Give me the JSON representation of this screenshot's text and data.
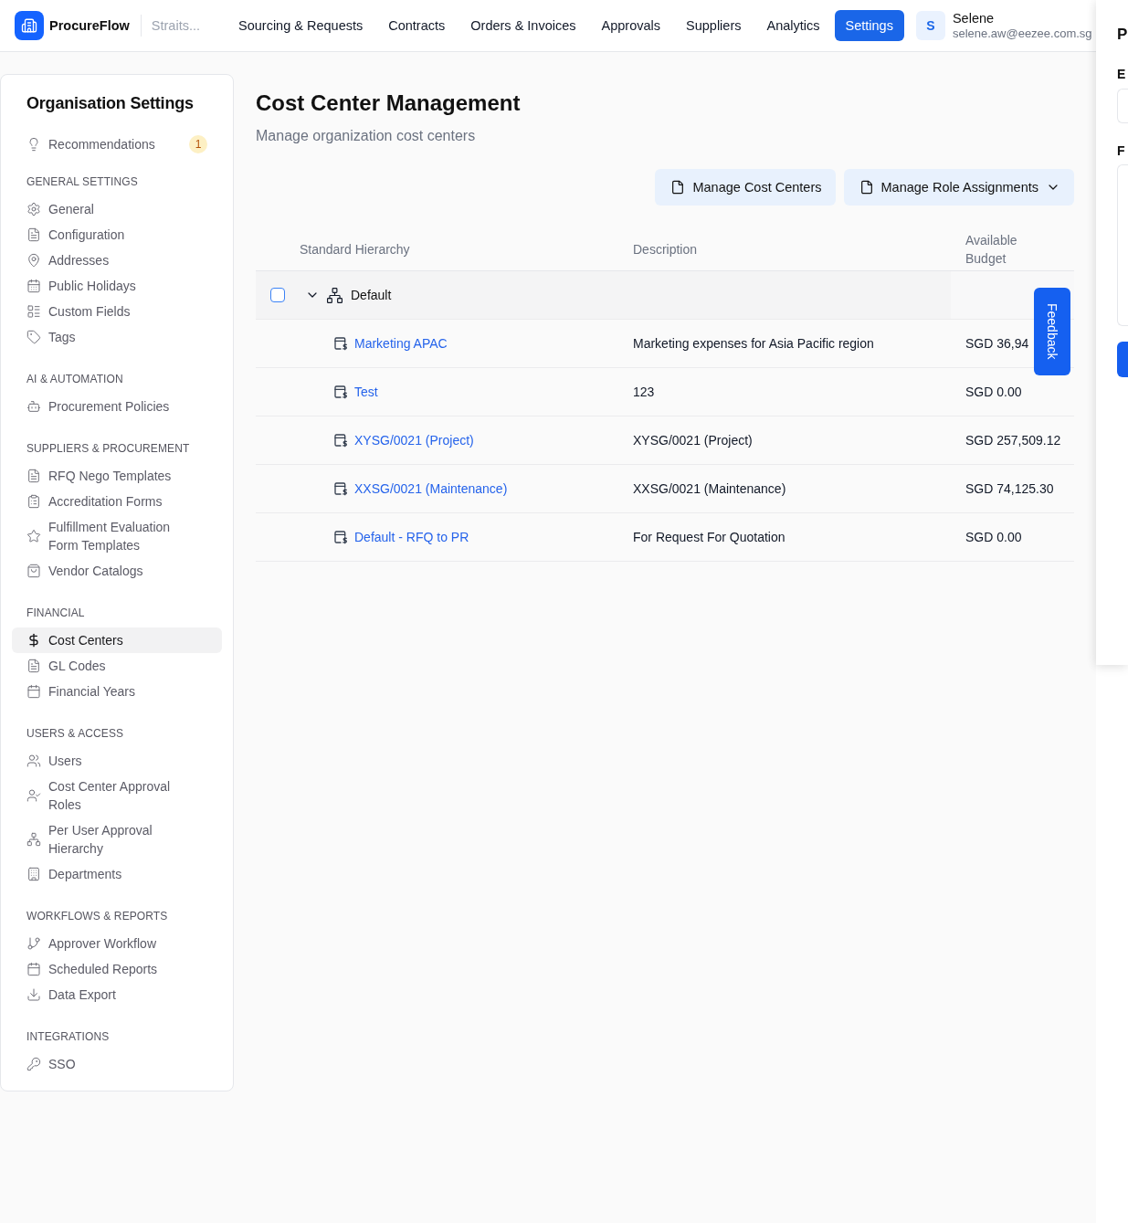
{
  "top_bar": {
    "brand": "ProcureFlow",
    "workspace": "Straits...",
    "nav": [
      {
        "label": "Sourcing & Requests",
        "selected": false
      },
      {
        "label": "Contracts",
        "selected": false
      },
      {
        "label": "Orders & Invoices",
        "selected": false
      },
      {
        "label": "Approvals",
        "selected": false
      },
      {
        "label": "Suppliers",
        "selected": false
      },
      {
        "label": "Analytics",
        "selected": false
      },
      {
        "label": "Settings",
        "selected": true
      }
    ],
    "user": {
      "avatar": "S",
      "name": "Selene",
      "email": "selene.aw@eezee.com.sg"
    }
  },
  "sidebar": {
    "title": "Organisation Settings",
    "recommendations": {
      "label": "Recommendations",
      "badge": "1",
      "selected": false
    },
    "sections": [
      {
        "heading": "GENERAL SETTINGS",
        "items": [
          {
            "label": "General",
            "selected": false
          },
          {
            "label": "Configuration",
            "selected": false
          },
          {
            "label": "Addresses",
            "selected": false
          },
          {
            "label": "Public Holidays",
            "selected": false
          },
          {
            "label": "Custom Fields",
            "selected": false
          },
          {
            "label": "Tags",
            "selected": false
          }
        ]
      },
      {
        "heading": "AI & AUTOMATION",
        "items": [
          {
            "label": "Procurement Policies",
            "selected": false
          }
        ]
      },
      {
        "heading": "SUPPLIERS & PROCUREMENT",
        "items": [
          {
            "label": "RFQ Nego Templates",
            "selected": false
          },
          {
            "label": "Accreditation Forms",
            "selected": false
          },
          {
            "label": "Fulfillment Evaluation Form Templates",
            "selected": false
          },
          {
            "label": "Vendor Catalogs",
            "selected": false
          }
        ]
      },
      {
        "heading": "FINANCIAL",
        "items": [
          {
            "label": "Cost Centers",
            "selected": true
          },
          {
            "label": "GL Codes",
            "selected": false
          },
          {
            "label": "Financial Years",
            "selected": false
          }
        ]
      },
      {
        "heading": "USERS & ACCESS",
        "items": [
          {
            "label": "Users",
            "selected": false
          },
          {
            "label": "Cost Center Approval Roles",
            "selected": false
          },
          {
            "label": "Per User Approval Hierarchy",
            "selected": false
          },
          {
            "label": "Departments",
            "selected": false
          }
        ]
      },
      {
        "heading": "WORKFLOWS & REPORTS",
        "items": [
          {
            "label": "Approver Workflow",
            "selected": false
          },
          {
            "label": "Scheduled Reports",
            "selected": false
          },
          {
            "label": "Data Export",
            "selected": false
          }
        ]
      },
      {
        "heading": "INTEGRATIONS",
        "items": [
          {
            "label": "SSO",
            "selected": false
          }
        ]
      }
    ]
  },
  "main": {
    "title": "Cost Center Management",
    "subtitle": "Manage organization cost centers",
    "actions": [
      {
        "label": "Manage Cost Centers",
        "kind": "button"
      },
      {
        "label": "Manage Role Assignments",
        "kind": "dropdown"
      }
    ],
    "table": {
      "columns": [
        "Standard Hierarchy",
        "Description",
        "Available Budget"
      ],
      "rows": [
        {
          "name": "Default",
          "checked": false,
          "expanded": true,
          "children": [
            {
              "name": "Marketing APAC",
              "description": "Marketing expenses for Asia Pacific region",
              "budget": "SGD 36,94"
            },
            {
              "name": "Test",
              "description": "123",
              "budget": "SGD 0.00"
            },
            {
              "name": "XYSG/0021 (Project)",
              "description": "XYSG/0021 (Project)",
              "budget": "SGD 257,509.12"
            },
            {
              "name": "XXSG/0021 (Maintenance)",
              "description": "XXSG/0021 (Maintenance)",
              "budget": "SGD 74,125.30"
            },
            {
              "name": "Default - RFQ to PR",
              "description": "For Request For Quotation",
              "budget": "SGD 0.00"
            }
          ]
        }
      ]
    }
  },
  "feedback_tab": {
    "label": "Feedback"
  },
  "side_panel": {
    "title": "P",
    "fields": [
      {
        "label": "E",
        "kind": "input"
      },
      {
        "label": "F",
        "kind": "textarea"
      }
    ]
  }
}
